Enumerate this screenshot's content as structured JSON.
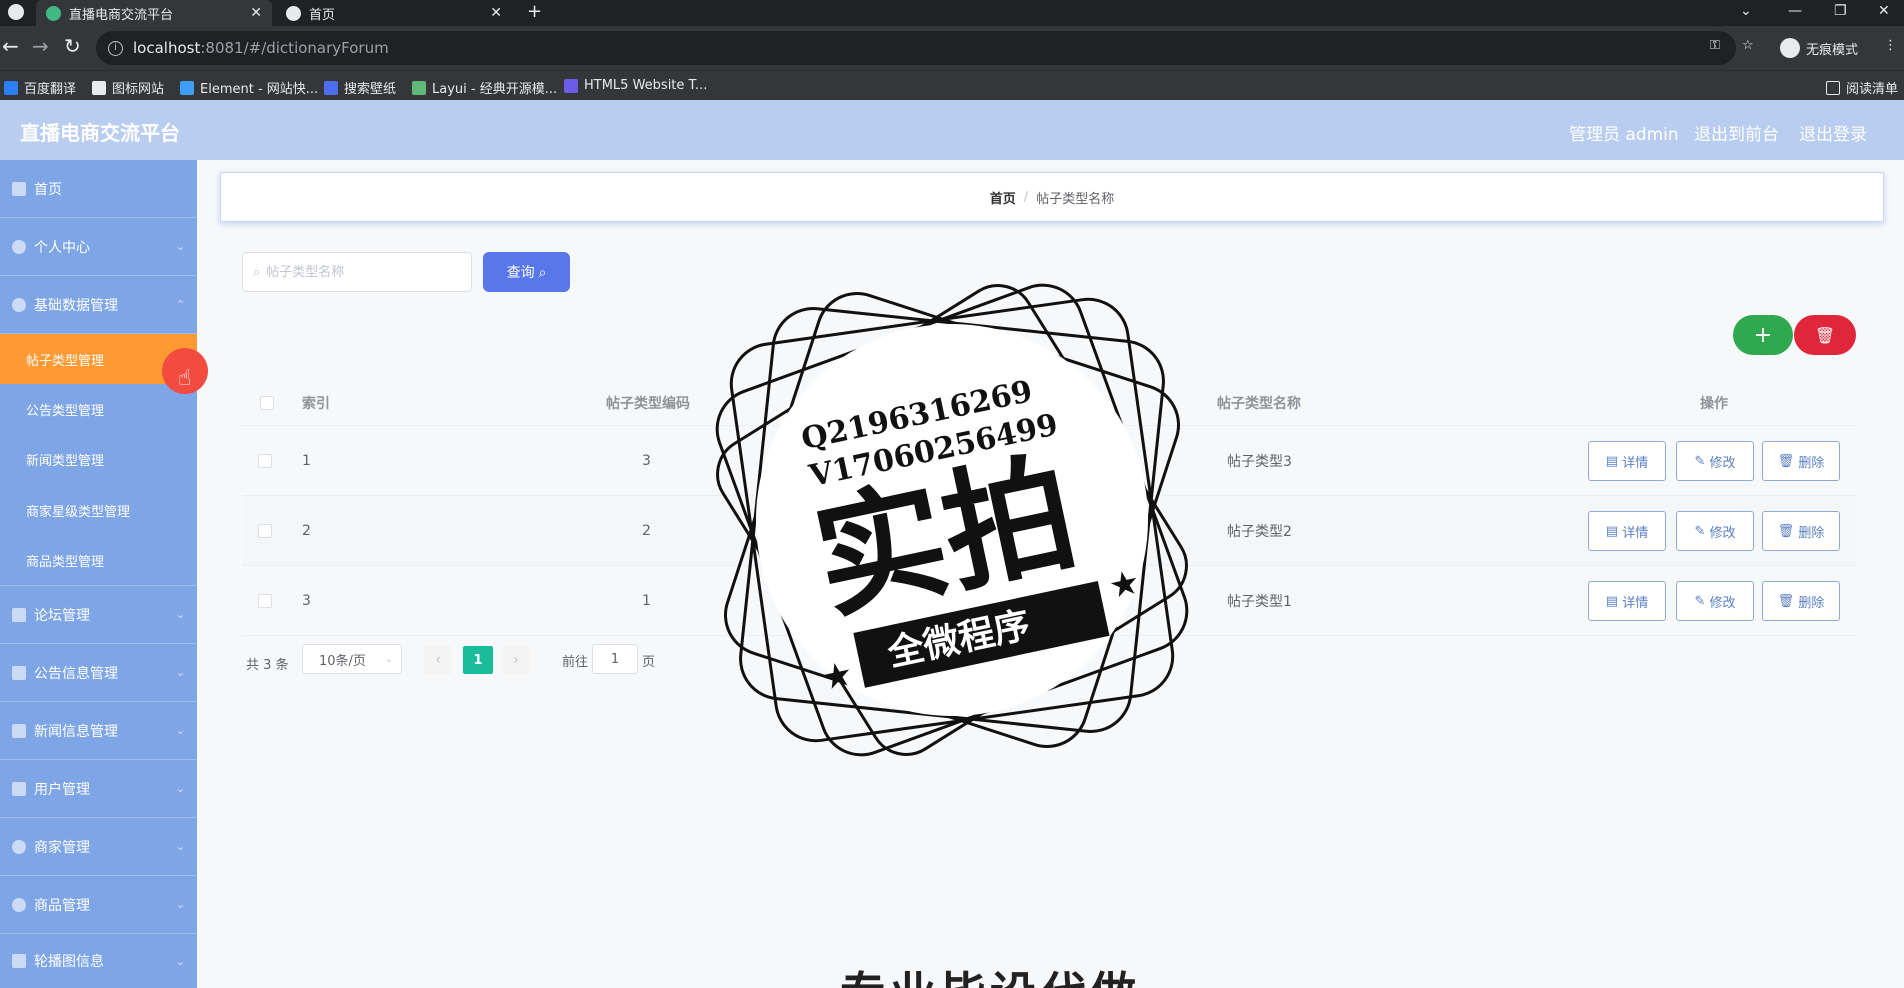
{
  "browser": {
    "tabs": [
      {
        "title": "直播电商交流平台"
      },
      {
        "title": "首页"
      }
    ],
    "url_host": "localhost",
    "url_path": ":8081/#/dictionaryForum",
    "incognito_label": "无痕模式",
    "bookmarks": [
      "百度翻译",
      "图标网站",
      "Element - 网站快...",
      "搜索壁纸",
      "Layui - 经典开源模...",
      "HTML5 Website T..."
    ],
    "reading_list": "阅读清单"
  },
  "header": {
    "title": "直播电商交流平台",
    "admin": "管理员 admin",
    "to_front": "退出到前台",
    "logout": "退出登录"
  },
  "sidebar": {
    "items": [
      {
        "label": "首页"
      },
      {
        "label": "个人中心"
      },
      {
        "label": "基础数据管理"
      }
    ],
    "sub_items": [
      {
        "label": "帖子类型管理"
      },
      {
        "label": "公告类型管理"
      },
      {
        "label": "新闻类型管理"
      },
      {
        "label": "商家星级类型管理"
      },
      {
        "label": "商品类型管理"
      }
    ],
    "more_items": [
      {
        "label": "论坛管理"
      },
      {
        "label": "公告信息管理"
      },
      {
        "label": "新闻信息管理"
      },
      {
        "label": "用户管理"
      },
      {
        "label": "商家管理"
      },
      {
        "label": "商品管理"
      },
      {
        "label": "轮播图信息"
      }
    ]
  },
  "breadcrumb": {
    "home": "首页",
    "separator": "/",
    "current": "帖子类型名称"
  },
  "search": {
    "placeholder": "帖子类型名称",
    "button": "查询"
  },
  "table": {
    "headers": [
      "索引",
      "帖子类型编码",
      "帖子类型名称",
      "操作"
    ],
    "rows": [
      {
        "index": "1",
        "code": "3",
        "name": "帖子类型3"
      },
      {
        "index": "2",
        "code": "2",
        "name": "帖子类型2"
      },
      {
        "index": "3",
        "code": "1",
        "name": "帖子类型1"
      }
    ],
    "actions": {
      "detail": "详情",
      "edit": "修改",
      "delete": "删除"
    }
  },
  "pagination": {
    "total": "共 3 条",
    "page_size": "10条/页",
    "current": "1",
    "goto_prefix": "前往",
    "goto_value": "1",
    "goto_suffix": "页"
  },
  "watermark": {
    "line1": "Q2196316269",
    "line2": "V17060256499",
    "big": "实拍",
    "ribbon": "全微程序"
  },
  "banner_text": "专业毕设代做"
}
